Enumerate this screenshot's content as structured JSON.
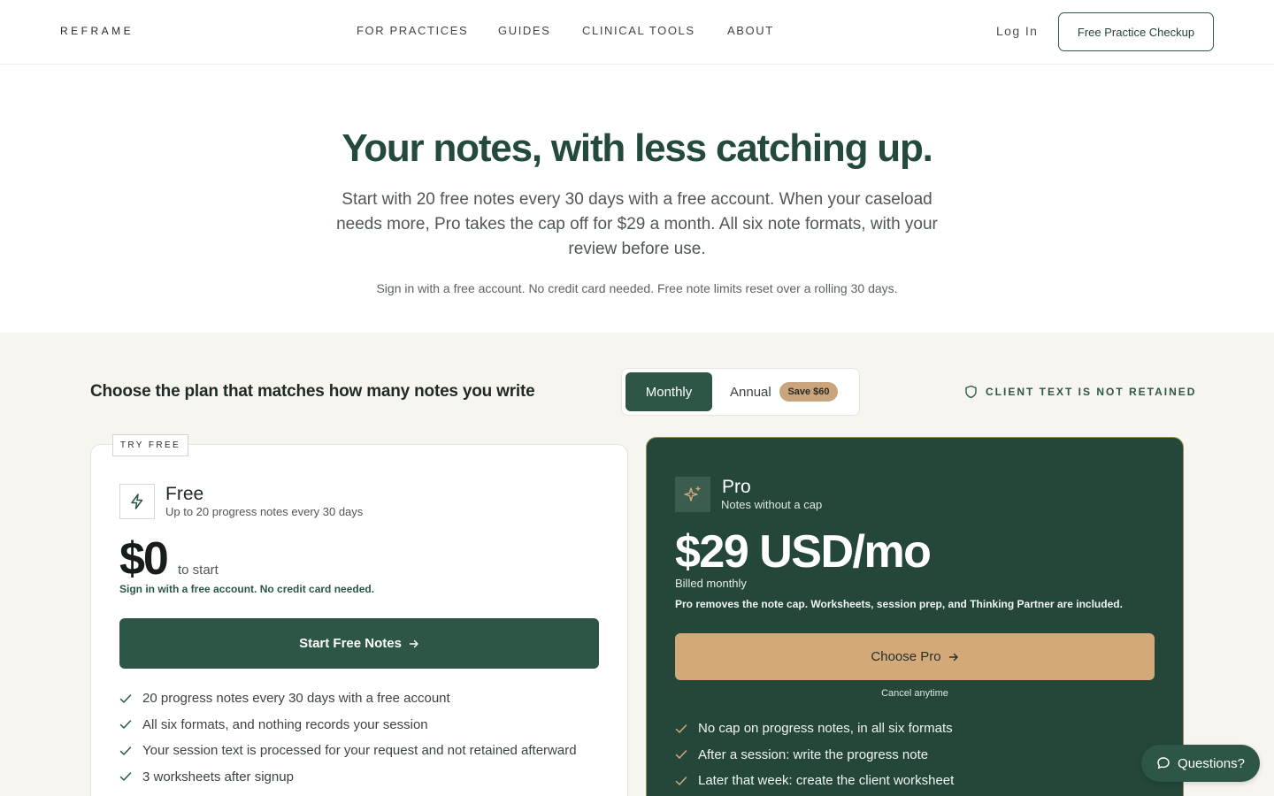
{
  "header": {
    "logo": "REFRAME",
    "nav": [
      {
        "label": "FOR PRACTICES"
      },
      {
        "label": "GUIDES"
      },
      {
        "label": "CLINICAL TOOLS"
      },
      {
        "label": "ABOUT"
      }
    ],
    "login": "Log In",
    "cta": "Free Practice Checkup"
  },
  "hero": {
    "title": "Your notes, with less catching up.",
    "subtitle": "Start with 20 free notes every 30 days with a free account. When your caseload needs more, Pro takes the cap off for $29 a month. All six note formats, with your review before use.",
    "note": "Sign in with a free account. No credit card needed. Free note limits reset over a rolling 30 days."
  },
  "plans": {
    "heading": "Choose the plan that matches how many notes you write",
    "toggle": {
      "monthly": "Monthly",
      "annual": "Annual",
      "save_badge": "Save $60",
      "selected": "Monthly"
    },
    "retained": "CLIENT TEXT IS NOT RETAINED",
    "free": {
      "tag": "TRY FREE",
      "icon": "lightning-icon",
      "name": "Free",
      "subtitle": "Up to 20 progress notes every 30 days",
      "price": "$0",
      "price_note": "to start",
      "signin_note": "Sign in with a free account. No credit card needed.",
      "button": "Start Free Notes",
      "features": [
        "20 progress notes every 30 days with a free account",
        "All six formats, and nothing records your session",
        "Your session text is processed for your request and not retained afterward",
        "3 worksheets after signup"
      ]
    },
    "pro": {
      "icon": "sparkle-icon",
      "name": "Pro",
      "subtitle": "Notes without a cap",
      "price": "$29 USD/mo",
      "billed": "Billed monthly",
      "description": "Pro removes the note cap. Worksheets, session prep, and Thinking Partner are included.",
      "button": "Choose Pro",
      "cancel": "Cancel anytime",
      "features": [
        "No cap on progress notes, in all six formats",
        "After a session: write the progress note",
        "Later that week: create the client worksheet"
      ]
    }
  },
  "chat": {
    "label": "Questions?"
  },
  "colors": {
    "brand_green": "#2d5646",
    "pro_card": "#24473a",
    "accent_tan": "#d4a97a",
    "section_bg": "#f7f5f0"
  }
}
